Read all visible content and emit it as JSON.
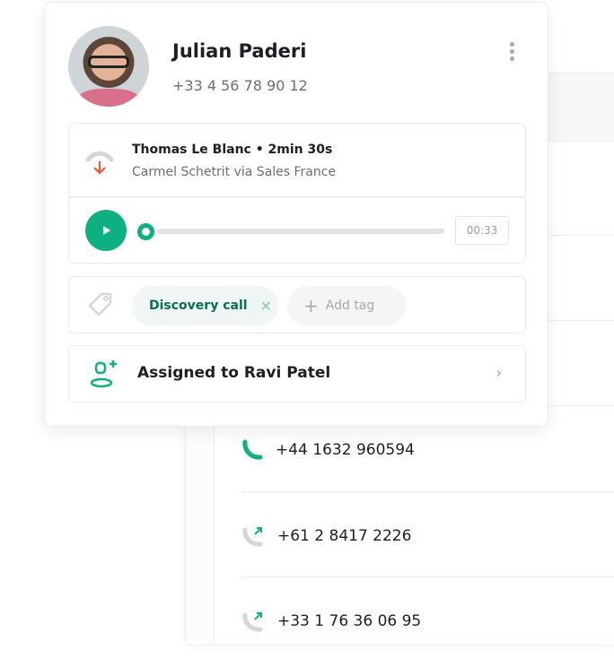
{
  "contact": {
    "name": "Julian Paderi",
    "phone": "+33 4 56 78 90 12"
  },
  "call": {
    "title": "Thomas Le Blanc • 2min 30s",
    "subtitle": "Carmel Schetrit via Sales France",
    "direction": "incoming",
    "player": {
      "time": "00:33",
      "progress": 0
    }
  },
  "tags": {
    "items": [
      {
        "label": "Discovery call",
        "remove": "✕"
      }
    ],
    "add_label": "Add tag"
  },
  "assignment": {
    "label": "Assigned to Ravi Patel"
  },
  "call_list": [
    {
      "number": "+44 1632 960594",
      "icon": "phone-icon"
    },
    {
      "number": "+61 2 8417 2226",
      "icon": "outgoing-call-icon"
    },
    {
      "number": "+33 1 76 36 06 95",
      "icon": "outgoing-call-icon"
    }
  ],
  "colors": {
    "accent": "#0cb17f",
    "missed": "#f0573a"
  }
}
